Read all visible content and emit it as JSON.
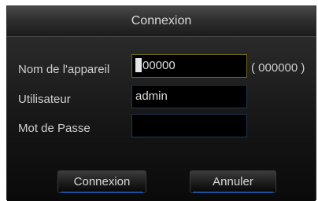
{
  "dialog": {
    "title": "Connexion",
    "fields": {
      "device": {
        "label": "Nom de l'appareil",
        "value": "00000",
        "hint": "( 000000 )"
      },
      "user": {
        "label": "Utilisateur",
        "value": "admin"
      },
      "password": {
        "label": "Mot de Passe",
        "value": ""
      }
    },
    "buttons": {
      "connect": "Connexion",
      "cancel": "Annuler"
    }
  },
  "colors": {
    "active_border": "#6e6a14",
    "field_border": "#1f3552",
    "button_underline": "#1a4f9a"
  }
}
